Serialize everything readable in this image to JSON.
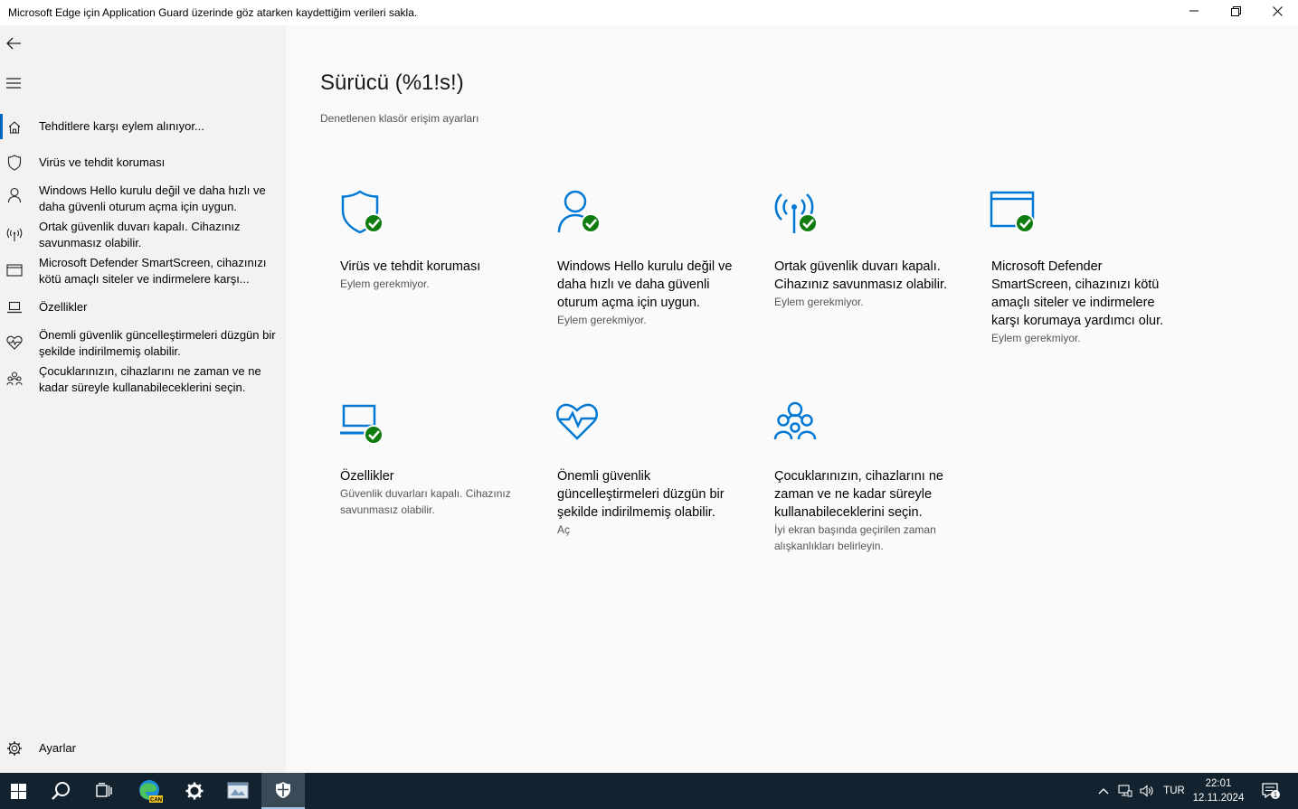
{
  "window": {
    "title": "Microsoft Edge için Application Guard üzerinde göz atarken kaydettiğim verileri sakla."
  },
  "sidebar": {
    "items": [
      {
        "label": "Tehditlere karşı eylem alınıyor...",
        "icon": "home-icon"
      },
      {
        "label": "Virüs ve tehdit koruması",
        "icon": "shield-icon"
      },
      {
        "label": "Windows Hello kurulu değil ve daha hızlı ve daha güvenli oturum açma için uygun.",
        "icon": "person-icon"
      },
      {
        "label": "Ortak güvenlik duvarı kapalı. Cihazınız savunmasız olabilir.",
        "icon": "wifi-antenna-icon"
      },
      {
        "label": "Microsoft Defender SmartScreen, cihazınızı kötü amaçlı siteler ve indirmelere karşı...",
        "icon": "browser-window-icon"
      },
      {
        "label": "Özellikler",
        "icon": "laptop-icon"
      },
      {
        "label": "Önemli güvenlik güncelleştirmeleri düzgün bir şekilde indirilmemiş olabilir.",
        "icon": "heart-pulse-icon"
      },
      {
        "label": "Çocuklarınızın, cihazlarını ne zaman ve ne kadar süreyle kullanabileceklerini seçin.",
        "icon": "family-icon"
      }
    ],
    "settings_label": "Ayarlar"
  },
  "main": {
    "title": "Sürücü (%1!s!)",
    "subtitle": "Denetlenen klasör erişim ayarları",
    "tiles": [
      {
        "title": "Virüs ve tehdit koruması",
        "desc": "Eylem gerekmiyor.",
        "icon": "shield-check-icon"
      },
      {
        "title": "Windows Hello kurulu değil ve daha hızlı ve daha güvenli oturum açma için uygun.",
        "desc": "Eylem gerekmiyor.",
        "icon": "person-check-icon"
      },
      {
        "title": "Ortak güvenlik duvarı kapalı. Cihazınız savunmasız olabilir.",
        "desc": "Eylem gerekmiyor.",
        "icon": "wifi-antenna-check-icon"
      },
      {
        "title": "Microsoft Defender SmartScreen, cihazınızı kötü amaçlı siteler ve indirmelere karşı korumaya yardımcı olur.",
        "desc": "Eylem gerekmiyor.",
        "icon": "browser-window-check-icon"
      },
      {
        "title": "Özellikler",
        "desc": "Güvenlik duvarları kapalı. Cihazınız savunmasız olabilir.",
        "icon": "laptop-check-icon"
      },
      {
        "title": "Önemli güvenlik güncelleştirmeleri düzgün bir şekilde indirilmemiş olabilir.",
        "desc": "Aç",
        "icon": "heart-pulse-icon"
      },
      {
        "title": "Çocuklarınızın, cihazlarını ne zaman ve ne kadar süreyle kullanabileceklerini seçin.",
        "desc": "İyi ekran başında geçirilen zaman alışkanlıkları belirleyin.",
        "icon": "family-icon"
      }
    ]
  },
  "taskbar": {
    "language": "TUR",
    "time": "22:01",
    "date": "12.11.2024",
    "notification_count": "1",
    "edge_badge": "CAN"
  },
  "colors": {
    "accent": "#0067c0",
    "icon_blue": "#0078d4",
    "check_green": "#107c10",
    "taskbar": "#12222e"
  }
}
